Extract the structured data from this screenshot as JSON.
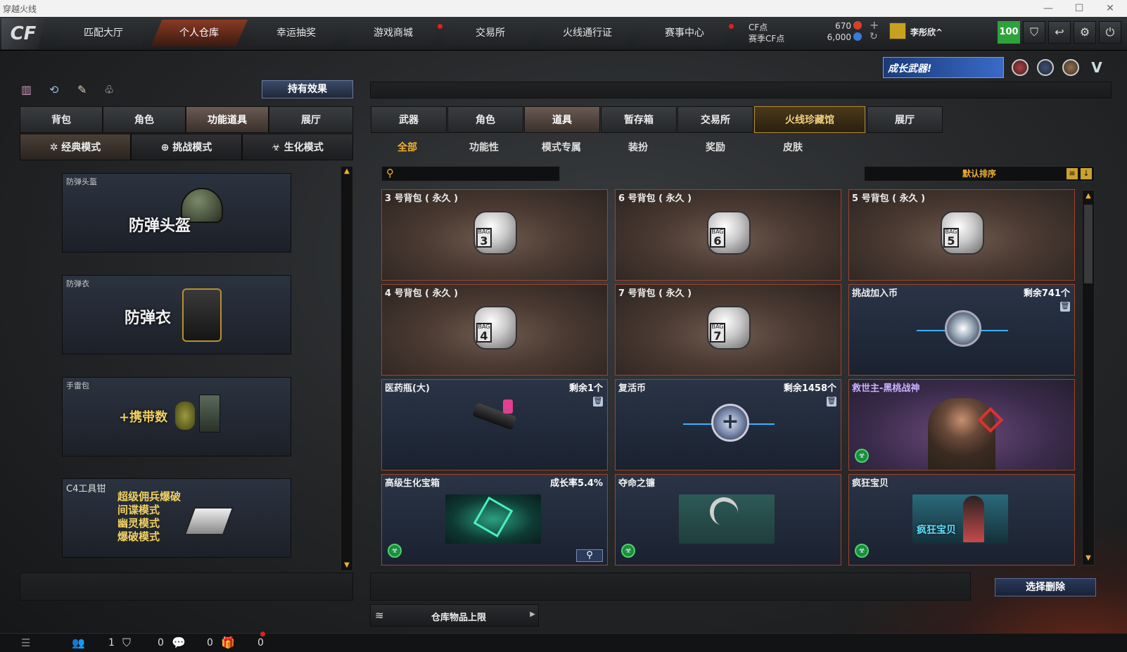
{
  "window": {
    "title": "穿越火线",
    "min": "—",
    "max": "☐",
    "close": "✕"
  },
  "logo": "CF",
  "nav": {
    "tabs": [
      "匹配大厅",
      "个人仓库",
      "幸运抽奖",
      "游戏商城",
      "交易所",
      "火线通行证",
      "赛事中心"
    ],
    "active": 1
  },
  "currency": {
    "cf_label": "CF点",
    "season_label": "赛季CF点",
    "cf_value": "670",
    "season_value": "6,000"
  },
  "user": {
    "name": "李彤欣^",
    "level": "100"
  },
  "banner": {
    "text": "成长武器!"
  },
  "left": {
    "effect_button": "持有效果",
    "tabs": [
      "背包",
      "角色",
      "功能道具",
      "展厅"
    ],
    "active_tab": 2,
    "modes": [
      "经典模式",
      "挑战模式",
      "生化模式"
    ],
    "active_mode": 0,
    "cards": [
      {
        "title": "防弹头盔",
        "main": "防弹头盔"
      },
      {
        "title": "防弹衣",
        "main": "防弹衣"
      },
      {
        "title": "手雷包",
        "main": "+携带数"
      },
      {
        "title": "C4工具钳",
        "lines": [
          "超级佣兵爆破",
          "间谍模式",
          "幽灵模式",
          "爆破模式"
        ]
      }
    ]
  },
  "right": {
    "tabs": [
      "武器",
      "角色",
      "道具",
      "暂存箱",
      "交易所",
      "火线珍藏馆",
      "展厅"
    ],
    "active_tab": 2,
    "subtabs": [
      "全部",
      "功能性",
      "模式专属",
      "装扮",
      "奖励",
      "皮肤"
    ],
    "active_subtab": 0,
    "search_placeholder": "",
    "sort": "默认排序",
    "items": [
      {
        "name": "3 号背包 ( 永久 )",
        "bag": "3",
        "type": "bag"
      },
      {
        "name": "6 号背包 ( 永久 )",
        "bag": "6",
        "type": "bag"
      },
      {
        "name": "5 号背包 ( 永久 )",
        "bag": "5",
        "type": "bag"
      },
      {
        "name": "4 号背包 ( 永久 )",
        "bag": "4",
        "type": "bag"
      },
      {
        "name": "7 号背包 ( 永久 )",
        "bag": "7",
        "type": "bag"
      },
      {
        "name": "挑战加入币",
        "count": "剩余741个",
        "type": "coin"
      },
      {
        "name": "医药瓶(大)",
        "count": "剩余1个",
        "type": "medkit"
      },
      {
        "name": "复活币",
        "count": "剩余1458个",
        "type": "revive"
      },
      {
        "name": "救世主-黑桃战神",
        "type": "character"
      },
      {
        "name": "高级生化宝箱",
        "count": "成长率5.4%",
        "type": "box"
      },
      {
        "name": "夺命之镰",
        "type": "scythe"
      },
      {
        "name": "疯狂宝贝",
        "type": "baby",
        "thumb_text": "疯狂宝贝"
      }
    ],
    "bag_label": "BAG",
    "delete_button": "选择删除",
    "storage_limit": "仓库物品上限"
  },
  "status": {
    "friends": "1",
    "shield": "0",
    "chat": "0",
    "gifts": "0"
  }
}
